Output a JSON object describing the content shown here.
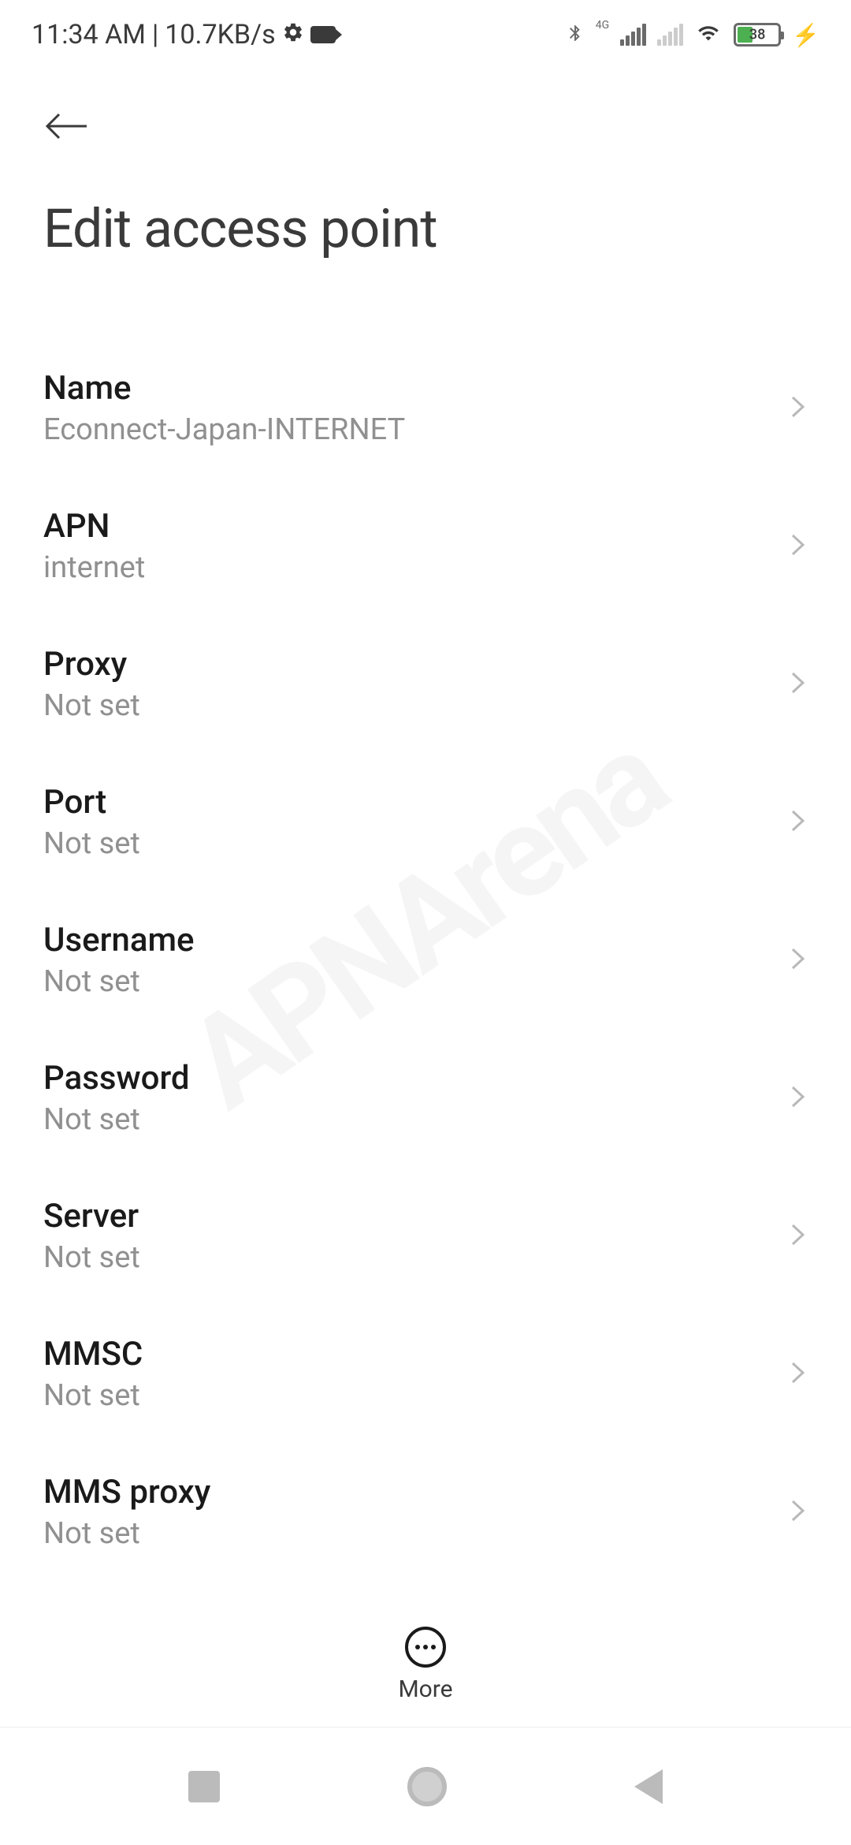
{
  "status_bar": {
    "time": "11:34 AM",
    "data_rate": "10.7KB/s",
    "network_label": "4G",
    "battery_percent": "38"
  },
  "header": {
    "title": "Edit access point"
  },
  "settings": [
    {
      "label": "Name",
      "value": "Econnect-Japan-INTERNET"
    },
    {
      "label": "APN",
      "value": "internet"
    },
    {
      "label": "Proxy",
      "value": "Not set"
    },
    {
      "label": "Port",
      "value": "Not set"
    },
    {
      "label": "Username",
      "value": "Not set"
    },
    {
      "label": "Password",
      "value": "Not set"
    },
    {
      "label": "Server",
      "value": "Not set"
    },
    {
      "label": "MMSC",
      "value": "Not set"
    },
    {
      "label": "MMS proxy",
      "value": "Not set"
    }
  ],
  "bottom_action": {
    "label": "More"
  },
  "watermark": "APNArena"
}
